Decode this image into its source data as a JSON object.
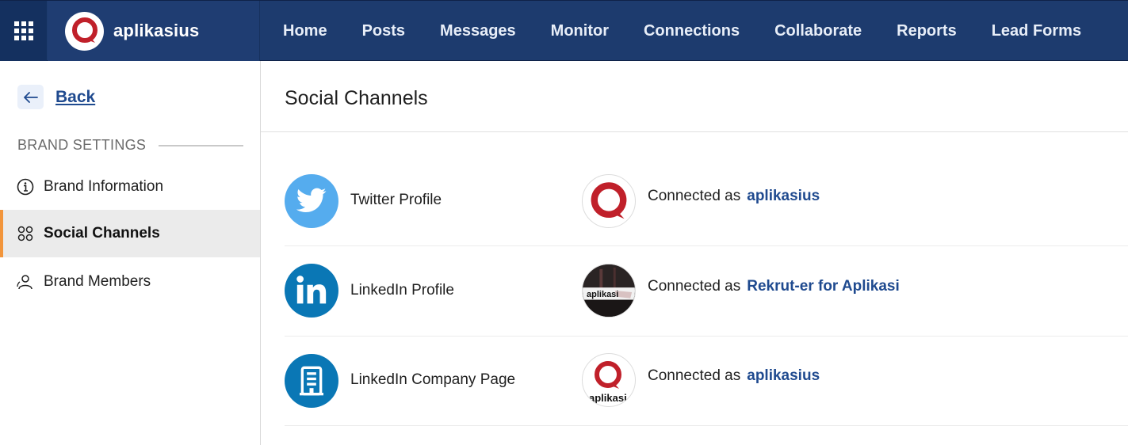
{
  "app": {
    "brand_name": "aplikasius",
    "logo_icon": "aplikasius-logo",
    "grid_icon": "apps-grid-icon"
  },
  "nav": {
    "items": [
      {
        "label": "Home"
      },
      {
        "label": "Posts"
      },
      {
        "label": "Messages"
      },
      {
        "label": "Monitor"
      },
      {
        "label": "Connections"
      },
      {
        "label": "Collaborate"
      },
      {
        "label": "Reports"
      },
      {
        "label": "Lead Forms"
      }
    ]
  },
  "sidebar": {
    "back_label": "Back",
    "section_heading": "BRAND SETTINGS",
    "items": [
      {
        "label": "Brand Information",
        "icon": "info-circle-icon",
        "active": false
      },
      {
        "label": "Social Channels",
        "icon": "social-network-icon",
        "active": true
      },
      {
        "label": "Brand Members",
        "icon": "users-icon",
        "active": false
      }
    ]
  },
  "main": {
    "title": "Social Channels",
    "channels": [
      {
        "network": "Twitter Profile",
        "icon": "twitter-icon",
        "icon_color": "#55acee",
        "connected_prefix": "Connected as",
        "account_name": "aplikasius",
        "avatar": "aplikasius-logo"
      },
      {
        "network": "LinkedIn Profile",
        "icon": "linkedin-icon",
        "icon_color": "#0a77b5",
        "connected_prefix": "Connected as",
        "account_name": "Rekrut-er for Aplikasi",
        "avatar": "rekruter-avatar",
        "avatar_text": "aplikasi"
      },
      {
        "network": "LinkedIn Company Page",
        "icon": "company-building-icon",
        "icon_color": "#0a77b5",
        "connected_prefix": "Connected as",
        "account_name": "aplikasius",
        "avatar": "aplikasi-company-logo",
        "avatar_text": "aplikasi"
      }
    ]
  },
  "colors": {
    "topbar": "#1d3b6e",
    "link": "#1f4a8f",
    "active_accent": "#f2953b",
    "logo_red": "#c0202a"
  }
}
